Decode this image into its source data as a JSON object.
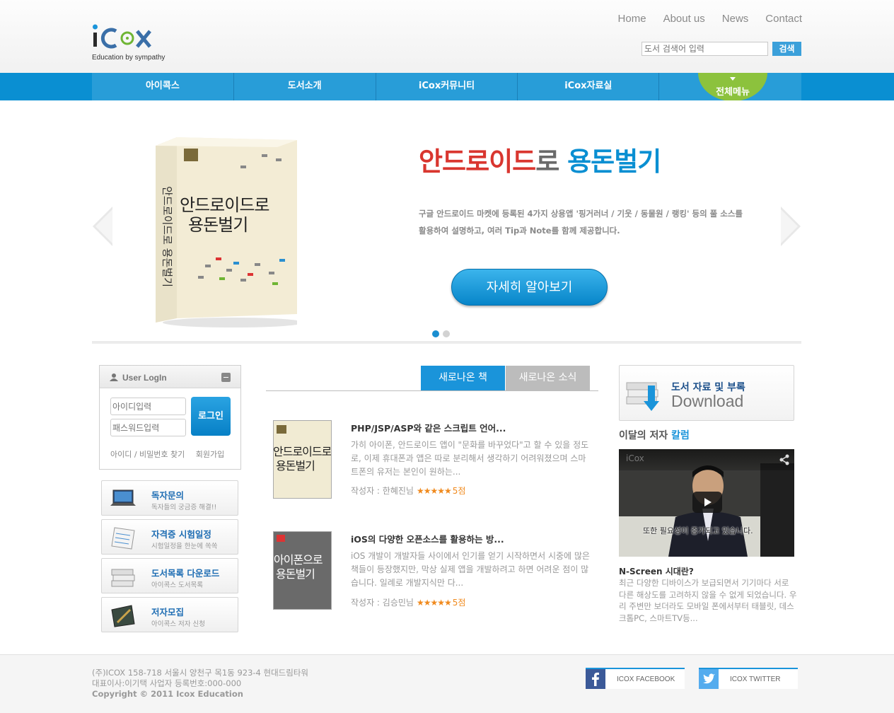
{
  "header": {
    "logo_text": "iCox",
    "tagline": "Education by sympathy",
    "top_nav": [
      "Home",
      "About us",
      "News",
      "Contact"
    ],
    "search": {
      "placeholder": "도서 검색어 입력",
      "button": "검색"
    }
  },
  "main_nav": {
    "items": [
      "아이콕스",
      "도서소개",
      "iCox커뮤니티",
      "iCox자료실"
    ],
    "all_menu": "전체메뉴"
  },
  "hero": {
    "title_part1": "안드로이드",
    "title_part2": "로 ",
    "title_part3": "용돈벌기",
    "desc_line1": "구글 안드로이드 마켓에 등록된 4가지 상용앱 '핑거러너 / 기웃 / 동물원 / 랭킹' 등의 풀 소스를",
    "desc_line2": "활용하여 설명하고, 여러 Tip과 Note를 함께 제공합니다.",
    "button": "자세히 알아보기",
    "book_cover_title1": "안드로이드로",
    "book_cover_title2": "용돈벌기",
    "book_spine": "안드로이드로 용돈벌기"
  },
  "login": {
    "title": "User LogIn",
    "id_placeholder": "아이디입력",
    "pw_placeholder": "패스워드입력",
    "button": "로그인",
    "find_link": "아이디 / 비밀번호 찾기",
    "join_link": "회원가입"
  },
  "quick_menu": [
    {
      "title": "독자문의",
      "sub": "독자들의 궁금증 해결!!"
    },
    {
      "title": "자격증 시험일정",
      "sub": "시험일정을 한눈에 쏙쏙"
    },
    {
      "title": "도서목록 다운로드",
      "sub": "아이콕스 도서목록"
    },
    {
      "title": "저자모집",
      "sub": "아이콕스 저자 신청"
    }
  ],
  "tabs": {
    "new_books": "새로나온 책",
    "news": "새로나온 소식"
  },
  "books": [
    {
      "title": "PHP/JSP/ASP와 같은 스크립트 언어...",
      "desc": "가히 아이폰, 안드로이드 앱이 \"문화를 바꾸었다\"고 할 수 있을 정도로, 이제 휴대폰과 앱은 따로 분리해서 생각하기 어려워졌으며 스마트폰의 유저는 본인이 원하는...",
      "author": "작성자 : 한혜진님",
      "stars": "★★★★★",
      "score": "5점",
      "cover1": "안드로이드로",
      "cover2": "용돈벌기"
    },
    {
      "title": "iOS의 다양한 오픈소스를 활용하는 방...",
      "desc": "iOS 개발이 개발자들 사이에서 인기를 얻기 시작하면서 시중에 많은 책들이 등장했지만, 막상 실제 앱을 개발하려고 하면 어려운 점이 많습니다. 일례로 개발지식만 다...",
      "author": "작성자 : 김승민님",
      "stars": "★★★★★",
      "score": "5점",
      "cover1": "아이폰으로",
      "cover2": "용돈벌기"
    }
  ],
  "download": {
    "title": "도서 자료 및 부록",
    "sub": "Download"
  },
  "column": {
    "title_part1": "이달의 저자 ",
    "title_part2": "칼럼",
    "video_brand": "iCox",
    "video_caption": "또한 필요성이 증가되고 있습니다.",
    "post_title": "N-Screen 시대란?",
    "post_desc": "최근 다양한 디바이스가 보급되면서 기기마다 서로 다른 해상도를 고려하지 않을 수 없게 되었습니다. 우리 주변만 보더라도 모바일 폰에서부터 태블릿, 데스크톱PC, 스마트TV등..."
  },
  "footer": {
    "address": "(주)ICOX 158-718 서울시 양천구 목1동 923-4 현대드림타워",
    "ceo": "대표이사:이기택 사업자 등록번호:000-000",
    "copyright": "Copyright © 2011 Icox Education",
    "facebook": "ICOX FACEBOOK",
    "twitter": "ICOX TWITTER"
  },
  "colors": {
    "brand_blue": "#0a8fd2",
    "accent_green": "#8cc23d",
    "accent_red": "#d9362f",
    "star_orange": "#f08a1e"
  },
  "icons": [
    "user-icon",
    "minimize-icon",
    "laptop-icon",
    "calendar-icon",
    "books-icon",
    "pen-icon",
    "download-icon",
    "share-icon",
    "play-icon",
    "facebook-icon",
    "twitter-icon",
    "chevron-left-icon",
    "chevron-right-icon"
  ]
}
